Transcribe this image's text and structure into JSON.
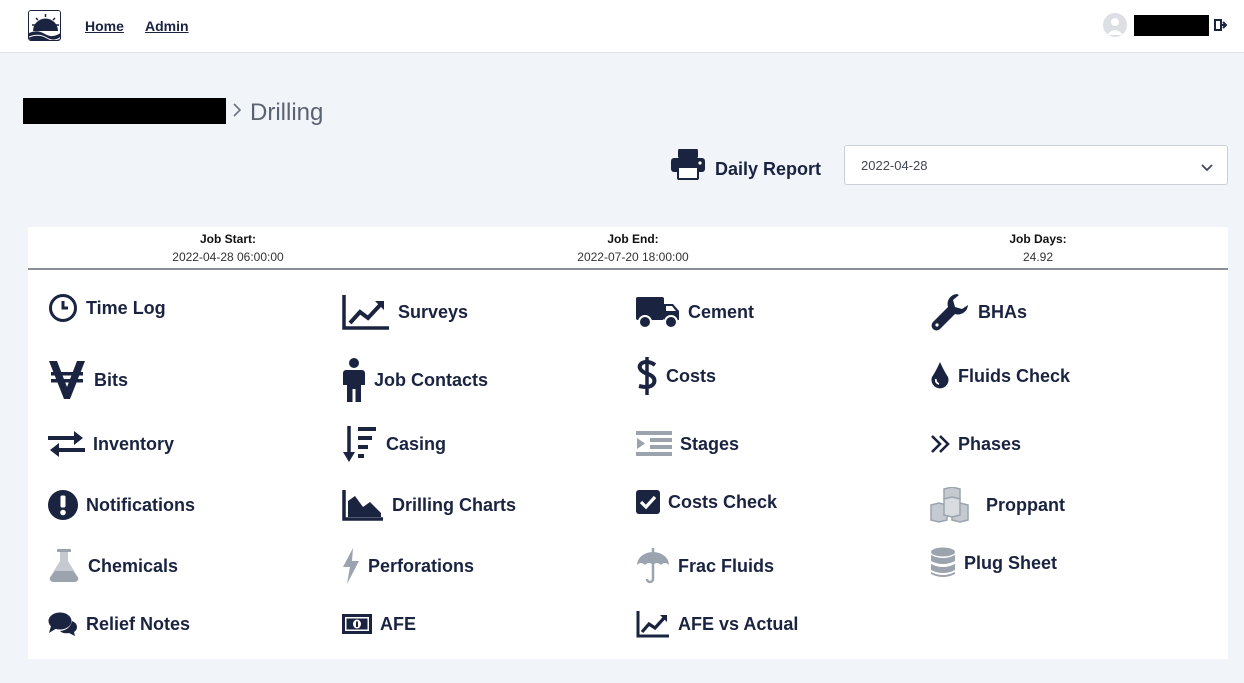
{
  "nav": {
    "home": "Home",
    "admin": "Admin"
  },
  "breadcrumb": {
    "separator": ">",
    "current": "Drilling"
  },
  "report": {
    "label": "Daily Report",
    "selected_date": "2022-04-28"
  },
  "job": {
    "start_label": "Job Start:",
    "start_value": "2022-04-28 06:00:00",
    "end_label": "Job End:",
    "end_value": "2022-07-20 18:00:00",
    "days_label": "Job Days:",
    "days_value": "24.92"
  },
  "tiles": [
    {
      "label": "Time Log",
      "icon": "clock-icon"
    },
    {
      "label": "Surveys",
      "icon": "line-chart-icon"
    },
    {
      "label": "Cement",
      "icon": "truck-icon"
    },
    {
      "label": "BHAs",
      "icon": "wrench-icon"
    },
    {
      "label": "Bits",
      "icon": "bits-icon"
    },
    {
      "label": "Job Contacts",
      "icon": "person-icon"
    },
    {
      "label": "Costs",
      "icon": "dollar-icon"
    },
    {
      "label": "Fluids Check",
      "icon": "droplet-icon"
    },
    {
      "label": "Inventory",
      "icon": "exchange-arrows-icon"
    },
    {
      "label": "Casing",
      "icon": "sort-down-icon"
    },
    {
      "label": "Stages",
      "icon": "indent-list-icon"
    },
    {
      "label": "Phases",
      "icon": "double-chevron-right-icon"
    },
    {
      "label": "Notifications",
      "icon": "exclamation-circle-icon"
    },
    {
      "label": "Drilling Charts",
      "icon": "area-chart-icon"
    },
    {
      "label": "Costs Check",
      "icon": "checkbox-icon"
    },
    {
      "label": "Proppant",
      "icon": "cubes-icon"
    },
    {
      "label": "Chemicals",
      "icon": "flask-icon"
    },
    {
      "label": "Perforations",
      "icon": "bolt-icon"
    },
    {
      "label": "Frac Fluids",
      "icon": "umbrella-icon"
    },
    {
      "label": "Plug Sheet",
      "icon": "database-icon"
    },
    {
      "label": "Relief Notes",
      "icon": "comments-icon"
    },
    {
      "label": "AFE",
      "icon": "money-bill-icon"
    },
    {
      "label": "AFE vs Actual",
      "icon": "line-chart-icon"
    }
  ],
  "colors": {
    "navy": "#1a2340",
    "muted_icon": "#9ba3ae",
    "background": "#f1f4f8"
  }
}
